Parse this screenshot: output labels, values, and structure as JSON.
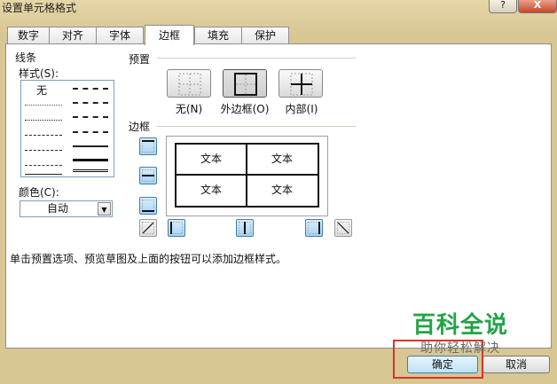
{
  "window": {
    "title": "设置单元格格式",
    "help": "?",
    "close": "X"
  },
  "tabs": [
    {
      "label": "数字"
    },
    {
      "label": "对齐"
    },
    {
      "label": "字体"
    },
    {
      "label": "边框",
      "active": true
    },
    {
      "label": "填充"
    },
    {
      "label": "保护"
    }
  ],
  "line": {
    "group": "线条",
    "style_label": "样式(S):",
    "none_label": "无",
    "color_label": "颜色(C):",
    "color_value": "自动"
  },
  "presets": {
    "group": "预置",
    "none": "无(N)",
    "outline": "外边框(O)",
    "inside": "内部(I)"
  },
  "border": {
    "group": "边框"
  },
  "preview": {
    "cells": [
      "文本",
      "文本",
      "文本",
      "文本"
    ]
  },
  "hint": "单击预置选项、预览草图及上面的按钮可以添加边框样式。",
  "buttons": {
    "ok": "确定",
    "cancel": "取消"
  },
  "watermark": {
    "title": "百科全说",
    "subtitle": "助你轻松解决"
  },
  "colors": {
    "accent": "#3c7fb1",
    "highlight": "#d9352a",
    "watermark": "#23a448"
  }
}
